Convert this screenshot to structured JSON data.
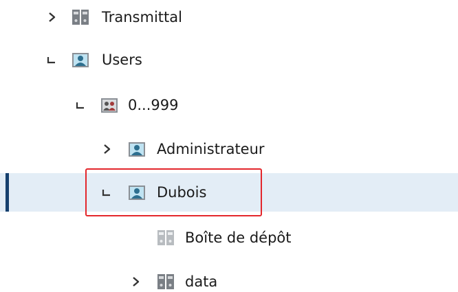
{
  "tree": {
    "nodes": [
      {
        "label": "Transmittal",
        "state": "collapsed",
        "icon": "folder-binder-icon"
      },
      {
        "label": "Users",
        "state": "expanded",
        "icon": "user-folder-icon"
      },
      {
        "label": "0...999",
        "state": "expanded",
        "icon": "group-folder-icon"
      },
      {
        "label": "Administrateur",
        "state": "collapsed",
        "icon": "user-folder-icon"
      },
      {
        "label": "Dubois",
        "state": "expanded",
        "icon": "user-folder-icon",
        "selected": true
      },
      {
        "label": "Boîte de dépôt",
        "state": "leaf",
        "icon": "dropbox-folder-icon"
      },
      {
        "label": "data",
        "state": "collapsed",
        "icon": "folder-binder-icon"
      }
    ]
  },
  "colors": {
    "selection_bg": "#e3edf6",
    "selection_bar": "#16406e",
    "highlight_border": "#e3262b",
    "text": "#1a1a1a"
  }
}
